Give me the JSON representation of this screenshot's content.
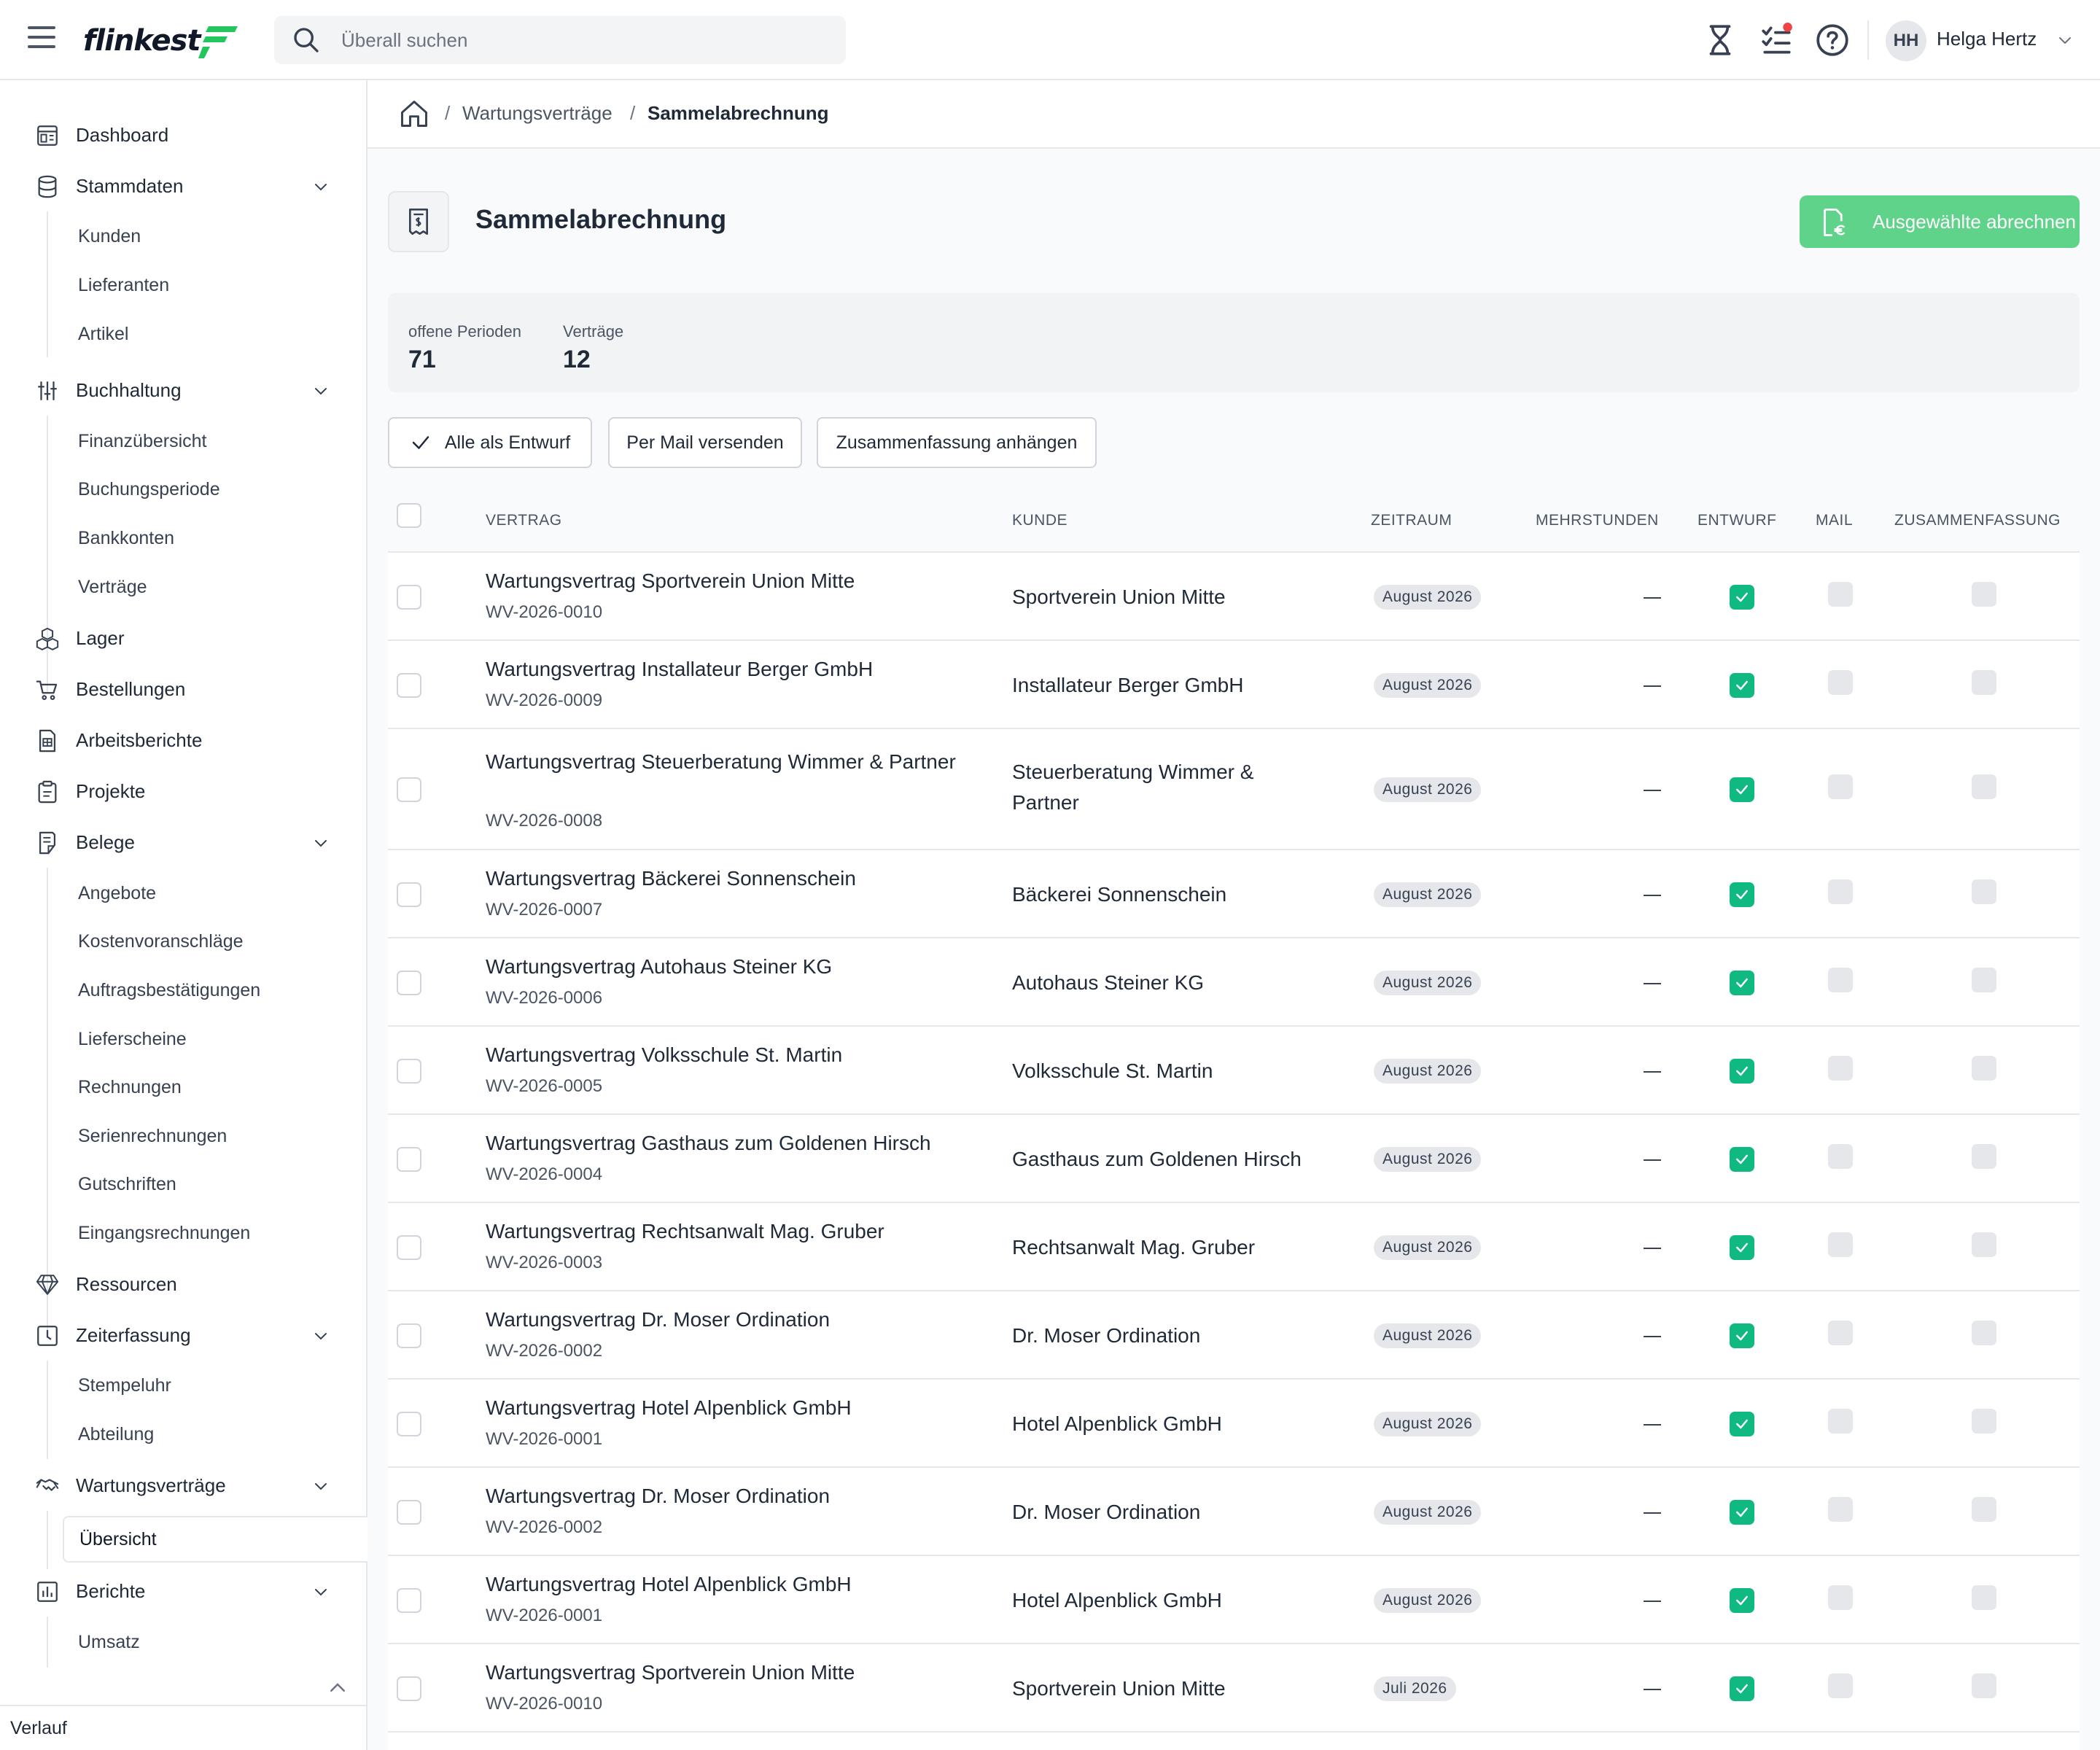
{
  "app": {
    "logo_text": "flinkest",
    "search": {
      "placeholder": "Überall suchen"
    },
    "user": {
      "initials": "HH",
      "name": "Helga Hertz"
    },
    "colors": {
      "accent": "#10b981",
      "primary_button": "#5fd38a",
      "notification_dot": "#ef4444"
    }
  },
  "sidebar": {
    "items": [
      {
        "label": "Dashboard",
        "icon": "dashboard-icon"
      },
      {
        "label": "Stammdaten",
        "icon": "database-icon",
        "expanded": true,
        "children": [
          "Kunden",
          "Lieferanten",
          "Artikel"
        ]
      },
      {
        "label": "Buchhaltung",
        "icon": "sliders-icon",
        "expanded": true,
        "children": [
          "Finanzübersicht",
          "Buchungsperiode",
          "Bankkonten",
          "Verträge"
        ]
      },
      {
        "label": "Lager",
        "icon": "boxes-icon"
      },
      {
        "label": "Bestellungen",
        "icon": "cart-icon"
      },
      {
        "label": "Arbeitsberichte",
        "icon": "report-icon"
      },
      {
        "label": "Projekte",
        "icon": "clipboard-icon"
      },
      {
        "label": "Belege",
        "icon": "document-icon",
        "expanded": true,
        "children": [
          "Angebote",
          "Kostenvoranschläge",
          "Auftragsbestätigungen",
          "Lieferscheine",
          "Rechnungen",
          "Serienrechnungen",
          "Gutschriften",
          "Eingangsrechnungen"
        ]
      },
      {
        "label": "Ressourcen",
        "icon": "diamond-icon"
      },
      {
        "label": "Zeiterfassung",
        "icon": "time-icon",
        "expanded": true,
        "children": [
          "Stempeluhr",
          "Abteilung"
        ]
      },
      {
        "label": "Wartungsverträge",
        "icon": "handshake-icon",
        "expanded": true,
        "children": [
          "Übersicht"
        ],
        "active_child": "Übersicht"
      },
      {
        "label": "Berichte",
        "icon": "bar-chart-icon",
        "expanded": true,
        "children": [
          "Umsatz"
        ]
      }
    ],
    "history_label": "Verlauf"
  },
  "breadcrumb": {
    "items": [
      "Wartungsverträge",
      "Sammelabrechnung"
    ],
    "separator": "/"
  },
  "page": {
    "title": "Sammelabrechnung",
    "primary_action": "Ausgewählte abrechnen",
    "stats": [
      {
        "label": "offene Perioden",
        "value": "71"
      },
      {
        "label": "Verträge",
        "value": "12"
      }
    ],
    "actions": [
      "Alle als Entwurf",
      "Per Mail versenden",
      "Zusammenfassung anhängen"
    ]
  },
  "table": {
    "columns": [
      "VERTRAG",
      "KUNDE",
      "ZEITRAUM",
      "MEHRSTUNDEN",
      "ENTWURF",
      "MAIL",
      "ZUSAMMENFASSUNG"
    ],
    "rows": [
      {
        "contract": "Wartungsvertrag Sportverein Union Mitte",
        "id": "WV-2026-0010",
        "customer": "Sportverein Union Mitte",
        "period": "August 2026",
        "overtime": "—",
        "draft": true,
        "mail": false,
        "summary": false
      },
      {
        "contract": "Wartungsvertrag Installateur Berger GmbH",
        "id": "WV-2026-0009",
        "customer": "Installateur Berger GmbH",
        "period": "August 2026",
        "overtime": "—",
        "draft": true,
        "mail": false,
        "summary": false
      },
      {
        "contract": "Wartungsvertrag Steuerberatung Wimmer & Partner",
        "id": "WV-2026-0008",
        "customer": "Steuerberatung Wimmer & Partner",
        "period": "August 2026",
        "overtime": "—",
        "draft": true,
        "mail": false,
        "summary": false
      },
      {
        "contract": "Wartungsvertrag Bäckerei Sonnenschein",
        "id": "WV-2026-0007",
        "customer": "Bäckerei Sonnenschein",
        "period": "August 2026",
        "overtime": "—",
        "draft": true,
        "mail": false,
        "summary": false
      },
      {
        "contract": "Wartungsvertrag Autohaus Steiner KG",
        "id": "WV-2026-0006",
        "customer": "Autohaus Steiner KG",
        "period": "August 2026",
        "overtime": "—",
        "draft": true,
        "mail": false,
        "summary": false
      },
      {
        "contract": "Wartungsvertrag Volksschule St. Martin",
        "id": "WV-2026-0005",
        "customer": "Volksschule St. Martin",
        "period": "August 2026",
        "overtime": "—",
        "draft": true,
        "mail": false,
        "summary": false
      },
      {
        "contract": "Wartungsvertrag Gasthaus zum Goldenen Hirsch",
        "id": "WV-2026-0004",
        "customer": "Gasthaus zum Goldenen Hirsch",
        "period": "August 2026",
        "overtime": "—",
        "draft": true,
        "mail": false,
        "summary": false
      },
      {
        "contract": "Wartungsvertrag Rechtsanwalt Mag. Gruber",
        "id": "WV-2026-0003",
        "customer": "Rechtsanwalt Mag. Gruber",
        "period": "August 2026",
        "overtime": "—",
        "draft": true,
        "mail": false,
        "summary": false
      },
      {
        "contract": "Wartungsvertrag Dr. Moser Ordination",
        "id": "WV-2026-0002",
        "customer": "Dr. Moser Ordination",
        "period": "August 2026",
        "overtime": "—",
        "draft": true,
        "mail": false,
        "summary": false
      },
      {
        "contract": "Wartungsvertrag Hotel Alpenblick GmbH",
        "id": "WV-2026-0001",
        "customer": "Hotel Alpenblick GmbH",
        "period": "August 2026",
        "overtime": "—",
        "draft": true,
        "mail": false,
        "summary": false
      },
      {
        "contract": "Wartungsvertrag Dr. Moser Ordination",
        "id": "WV-2026-0002",
        "customer": "Dr. Moser Ordination",
        "period": "August 2026",
        "overtime": "—",
        "draft": true,
        "mail": false,
        "summary": false
      },
      {
        "contract": "Wartungsvertrag Hotel Alpenblick GmbH",
        "id": "WV-2026-0001",
        "customer": "Hotel Alpenblick GmbH",
        "period": "August 2026",
        "overtime": "—",
        "draft": true,
        "mail": false,
        "summary": false
      },
      {
        "contract": "Wartungsvertrag Sportverein Union Mitte",
        "id": "WV-2026-0010",
        "customer": "Sportverein Union Mitte",
        "period": "Juli 2026",
        "overtime": "—",
        "draft": true,
        "mail": false,
        "summary": false
      }
    ]
  }
}
